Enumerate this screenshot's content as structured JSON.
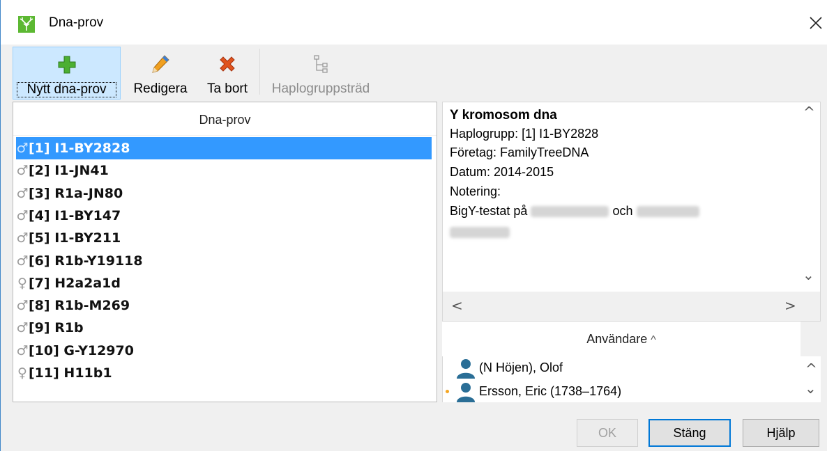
{
  "window": {
    "title": "Dna-prov"
  },
  "toolbar": {
    "new_label": "Nytt dna-prov",
    "edit_label": "Redigera",
    "delete_label": "Ta bort",
    "tree_label": "Haplogruppsträd"
  },
  "list": {
    "header": "Dna-prov",
    "items": [
      {
        "symbol": "♂",
        "label": "[1] I1-BY2828"
      },
      {
        "symbol": "♂",
        "label": "[2] I1-JN41"
      },
      {
        "symbol": "♂",
        "label": "[3] R1a-JN80"
      },
      {
        "symbol": "♂",
        "label": "[4] I1-BY147"
      },
      {
        "symbol": "♂",
        "label": "[5] I1-BY211"
      },
      {
        "symbol": "♂",
        "label": "[6] R1b-Y19118"
      },
      {
        "symbol": "♀",
        "label": "[7] H2a2a1d"
      },
      {
        "symbol": "♂",
        "label": "[8] R1b-M269"
      },
      {
        "symbol": "♂",
        "label": "[9] R1b"
      },
      {
        "symbol": "♂",
        "label": "[10] G-Y12970"
      },
      {
        "symbol": "♀",
        "label": "[11] H11b1"
      }
    ],
    "selected_index": 0
  },
  "info": {
    "title": "Y kromosom dna",
    "haplogroup": "Haplogrupp: [1] I1-BY2828",
    "company": "Företag: FamilyTreeDNA",
    "date": "Datum: 2014-2015",
    "note_label": "Notering:",
    "note_start": "BigY-testat på",
    "note_mid": "och"
  },
  "users": {
    "header": "Användare",
    "sort_indicator": "^",
    "items": [
      {
        "name": "(N Höjen), Olof"
      },
      {
        "name": "Ersson, Eric (1738–1764)"
      }
    ]
  },
  "buttons": {
    "ok": "OK",
    "close": "Stäng",
    "help": "Hjälp"
  },
  "colors": {
    "selection": "#3399ff",
    "window_border": "#3f86c8",
    "user_icon": "#2a6e96",
    "add_icon": "#4caf32",
    "delete_icon": "#e0541e"
  },
  "icons": {
    "app": "app-tree-icon",
    "close": "close-icon",
    "new": "plus-icon",
    "edit": "pencil-icon",
    "delete": "x-icon",
    "tree": "tree-icon",
    "user": "person-icon"
  }
}
